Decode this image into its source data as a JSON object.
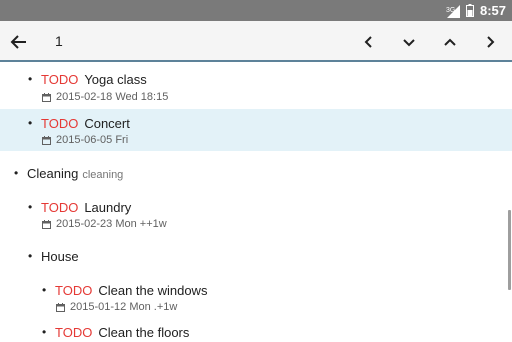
{
  "status_bar": {
    "network": "3G",
    "time": "8:57"
  },
  "toolbar": {
    "query": "1"
  },
  "items": [
    {
      "keyword": "TODO",
      "title": "Yoga class",
      "date": "2015-02-18 Wed 18:15"
    },
    {
      "keyword": "TODO",
      "title": "Concert",
      "date": "2015-06-05 Fri"
    },
    {
      "title": "Cleaning",
      "tag": "cleaning"
    },
    {
      "keyword": "TODO",
      "title": "Laundry",
      "date": "2015-02-23 Mon ++1w"
    },
    {
      "title": "House"
    },
    {
      "keyword": "TODO",
      "title": "Clean the windows",
      "date": "2015-01-12 Mon .+1w"
    },
    {
      "keyword": "TODO",
      "title": "Clean the floors"
    }
  ],
  "colors": {
    "todo": "#e53935",
    "selected_row": "#e3f2f8",
    "status_bar": "#7a7a7a"
  }
}
